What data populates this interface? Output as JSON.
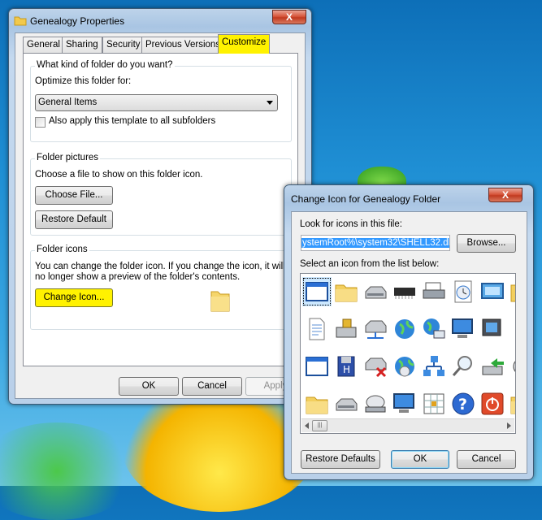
{
  "properties_dialog": {
    "title": "Genealogy Properties",
    "close_label": "X",
    "tabs": [
      {
        "label": "General"
      },
      {
        "label": "Sharing"
      },
      {
        "label": "Security"
      },
      {
        "label": "Previous Versions"
      },
      {
        "label": "Customize"
      }
    ],
    "active_tab": "Customize",
    "folder_kind": {
      "title": "What kind of folder do you want?",
      "optimize_label": "Optimize this folder for:",
      "optimize_value": "General Items",
      "subfolders_label": "Also apply this template to all subfolders",
      "subfolders_checked": false
    },
    "folder_pictures": {
      "title": "Folder pictures",
      "description": "Choose a file to show on this folder icon.",
      "choose_button": "Choose File...",
      "restore_button": "Restore Default"
    },
    "folder_icons": {
      "title": "Folder icons",
      "description_line1": "You can change the folder icon. If you change the icon, it will",
      "description_line2": "no longer show a preview of the folder's contents.",
      "change_button": "Change Icon..."
    },
    "buttons": {
      "ok": "OK",
      "cancel": "Cancel",
      "apply": "Apply"
    }
  },
  "change_icon_dialog": {
    "title": "Change Icon for Genealogy Folder",
    "close_label": "X",
    "look_label": "Look for icons in this file:",
    "file_path": "ystemRoot%\\system32\\SHELL32.dll",
    "browse_button": "Browse...",
    "select_label": "Select an icon from the list below:",
    "icons": [
      "window-icon",
      "folder-icon",
      "drive-icon",
      "memory-chip-icon",
      "printer-icon",
      "clock-icon",
      "display-icon",
      "folder-cut-icon",
      "document-icon",
      "drive-install-icon",
      "network-drive-icon",
      "globe-icon",
      "network-globe-icon",
      "computer-icon",
      "monitor-icon",
      "shortcut-icon",
      "window-icon",
      "floppy-icon",
      "network-drive-error-icon",
      "cd-globe-icon",
      "network-icon",
      "search-icon",
      "drive-arrow-icon",
      "cd-icon",
      "folder-icon",
      "drive-icon",
      "cd-drive-icon",
      "computer-icon",
      "table-icon",
      "help-icon",
      "power-icon",
      "folder-icon"
    ],
    "selected_index": 0,
    "buttons": {
      "restore_defaults": "Restore Defaults",
      "ok": "OK",
      "cancel": "Cancel"
    }
  },
  "colors": {
    "highlight": "#fff200",
    "selection": "#3399ff",
    "accent": "#3c7fb1"
  }
}
